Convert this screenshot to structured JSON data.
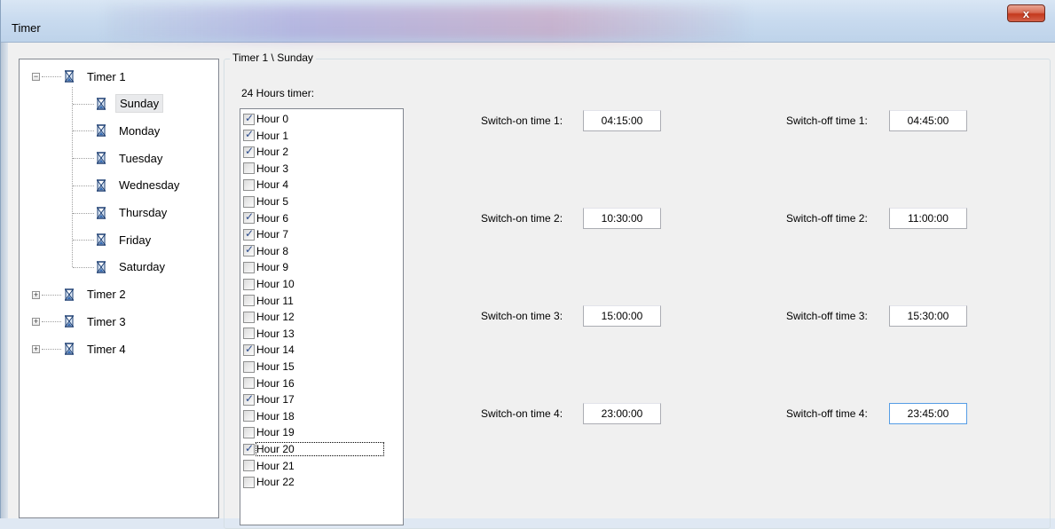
{
  "window": {
    "title": "Timer",
    "close_label": "x"
  },
  "tree": {
    "timers": [
      {
        "label": "Timer 1",
        "expanded": true,
        "days": [
          "Sunday",
          "Monday",
          "Tuesday",
          "Wednesday",
          "Thursday",
          "Friday",
          "Saturday"
        ],
        "selected": "Sunday"
      },
      {
        "label": "Timer 2",
        "expanded": false
      },
      {
        "label": "Timer 3",
        "expanded": false
      },
      {
        "label": "Timer 4",
        "expanded": false
      }
    ]
  },
  "group": {
    "title": "Timer 1 \\ Sunday",
    "hours_label": "24 Hours timer:"
  },
  "hours": [
    {
      "label": "Hour 0",
      "checked": true
    },
    {
      "label": "Hour 1",
      "checked": true
    },
    {
      "label": "Hour 2",
      "checked": true
    },
    {
      "label": "Hour 3",
      "checked": false
    },
    {
      "label": "Hour 4",
      "checked": false
    },
    {
      "label": "Hour 5",
      "checked": false
    },
    {
      "label": "Hour 6",
      "checked": true
    },
    {
      "label": "Hour 7",
      "checked": true
    },
    {
      "label": "Hour 8",
      "checked": true
    },
    {
      "label": "Hour 9",
      "checked": false
    },
    {
      "label": "Hour 10",
      "checked": false
    },
    {
      "label": "Hour 11",
      "checked": false
    },
    {
      "label": "Hour 12",
      "checked": false
    },
    {
      "label": "Hour 13",
      "checked": false
    },
    {
      "label": "Hour 14",
      "checked": true
    },
    {
      "label": "Hour 15",
      "checked": false
    },
    {
      "label": "Hour 16",
      "checked": false
    },
    {
      "label": "Hour 17",
      "checked": true
    },
    {
      "label": "Hour 18",
      "checked": false
    },
    {
      "label": "Hour 19",
      "checked": false
    },
    {
      "label": "Hour 20",
      "checked": true,
      "focused": true
    },
    {
      "label": "Hour 21",
      "checked": false
    },
    {
      "label": "Hour 22",
      "checked": false
    }
  ],
  "switch_times": [
    {
      "on_label": "Switch-on time 1:",
      "on_value": "04:15:00",
      "off_label": "Switch-off time 1:",
      "off_value": "04:45:00"
    },
    {
      "on_label": "Switch-on time 2:",
      "on_value": "10:30:00",
      "off_label": "Switch-off time 2:",
      "off_value": "11:00:00"
    },
    {
      "on_label": "Switch-on time 3:",
      "on_value": "15:00:00",
      "off_label": "Switch-off time 3:",
      "off_value": "15:30:00"
    },
    {
      "on_label": "Switch-on time 4:",
      "on_value": "23:00:00",
      "off_label": "Switch-off time 4:",
      "off_value": "23:45:00"
    }
  ]
}
